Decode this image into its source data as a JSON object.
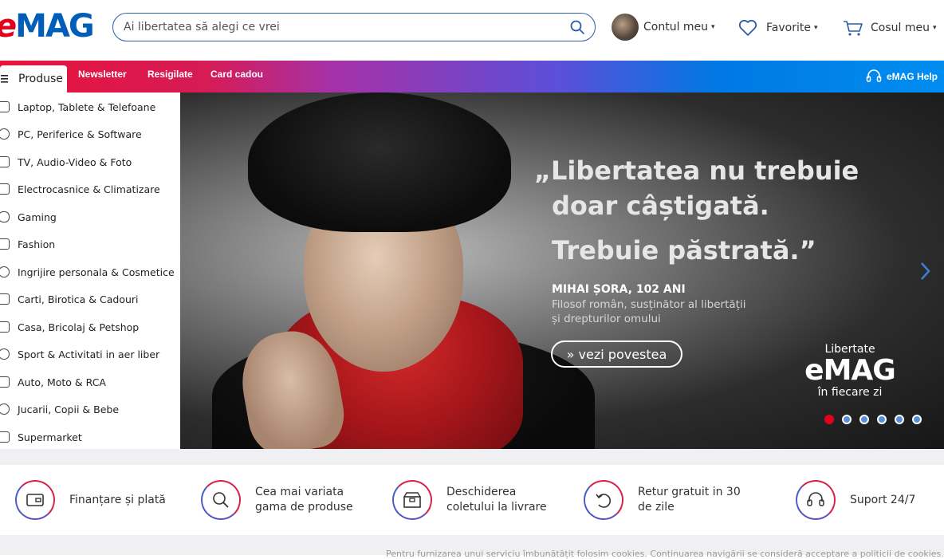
{
  "header": {
    "logo_e": "e",
    "logo_mag": "MAG",
    "search_placeholder": "Ai libertatea să alegi ce vrei",
    "account_label": "Contul meu",
    "favorites_label": "Favorite",
    "cart_label": "Cosul meu",
    "caret": "▾"
  },
  "nav": {
    "produse_label": "Produse",
    "links": [
      "Newsletter",
      "Resigilate",
      "Card cadou"
    ],
    "help_label": "eMAG Help"
  },
  "sidebar": {
    "categories": [
      "Laptop, Tablete & Telefoane",
      "PC, Periferice & Software",
      "TV, Audio-Video & Foto",
      "Electrocasnice & Climatizare",
      "Gaming",
      "Fashion",
      "Ingrijire personala & Cosmetice",
      "Carti, Birotica & Cadouri",
      "Casa, Bricolaj & Petshop",
      "Sport & Activitati in aer liber",
      "Auto, Moto & RCA",
      "Jucarii, Copii & Bebe",
      "Supermarket"
    ]
  },
  "hero": {
    "quote_line1": "„Libertatea nu trebuie",
    "quote_line2": "doar câștigată.",
    "quote_line3": "Trebuie păstrată.”",
    "author": "MIHAI ȘORA, 102 ANI",
    "desc_line1": "Filosof român, susținător al libertății",
    "desc_line2": "și drepturilor omului",
    "cta": "» vezi povestea",
    "brand_top": "Libertate",
    "brand_logo": "eMAG",
    "brand_bottom": "în fiecare zi",
    "slides_total": 6,
    "active_slide": 1
  },
  "features": [
    {
      "line1": "Finanțare și plată",
      "line2": "",
      "icon": "wallet-icon"
    },
    {
      "line1": "Cea mai variata",
      "line2": "gama de produse",
      "icon": "magnifier-icon"
    },
    {
      "line1": "Deschiderea",
      "line2": "coletului la livrare",
      "icon": "box-icon"
    },
    {
      "line1": "Retur gratuit in 30",
      "line2": "de zile",
      "icon": "return-icon"
    },
    {
      "line1": "Suport 24/7",
      "line2": "",
      "icon": "headset-icon"
    }
  ],
  "cookie_text": "Pentru furnizarea unui serviciu îmbunătățit folosim cookies. Continuarea navigării se consideră acceptare a politicii de cookies.",
  "colors": {
    "brand_red": "#e2001a",
    "brand_blue": "#005eb8",
    "nav_gradient_start": "#e8133a",
    "nav_gradient_end": "#008df0"
  }
}
